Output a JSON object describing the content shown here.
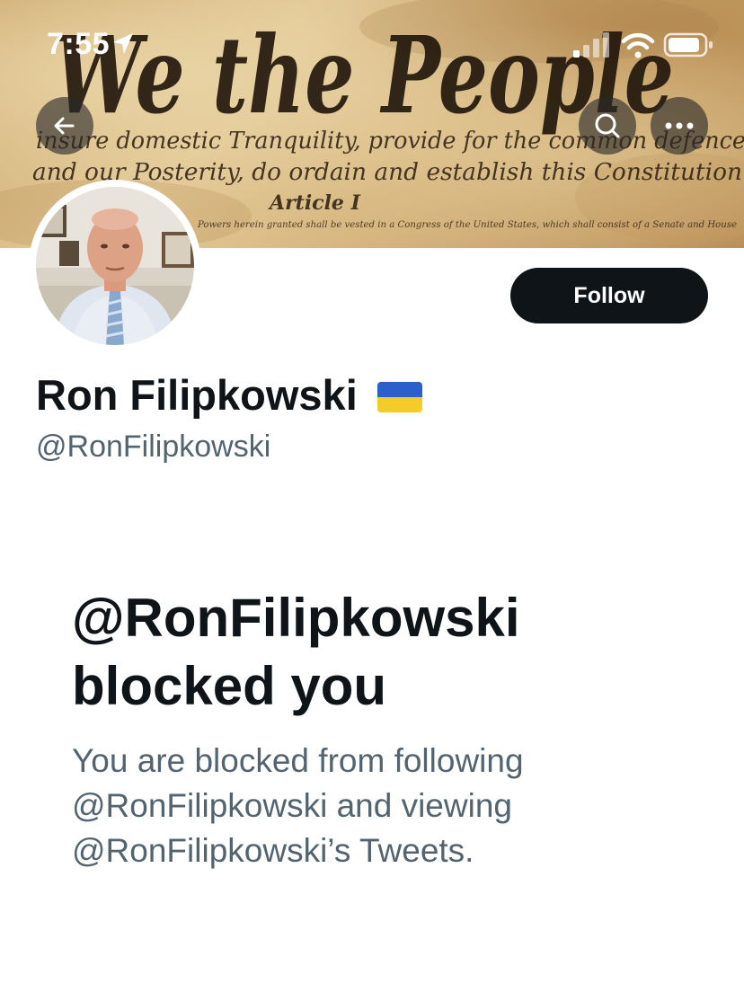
{
  "status_bar": {
    "time": "7:55",
    "icons": [
      "location-arrow-icon",
      "cellular-signal-icon",
      "wifi-icon",
      "battery-icon"
    ]
  },
  "banner": {
    "script_title": "We the People",
    "script_line_1": "insure domestic Tranquility, provide for the common defence",
    "script_line_2": "and our Posterity, do ordain and establish this Constitution",
    "script_article": "Article I",
    "script_line_3": "Powers herein granted shall be vested in a Congress of the United States, which shall consist of a Senate and House"
  },
  "nav": {
    "back_icon": "arrow-left-icon",
    "search_icon": "search-icon",
    "more_icon": "more-horizontal-icon"
  },
  "profile": {
    "display_name": "Ron Filipkowski",
    "flag_icon": "ukraine-flag-icon",
    "handle": "@RonFilipkowski",
    "follow_label": "Follow"
  },
  "blocked": {
    "title_line_1": "@RonFilipkowski",
    "title_line_2": "blocked you",
    "desc_line_1": "You are blocked from following",
    "desc_line_2": "@RonFilipkowski and viewing",
    "desc_line_3": "@RonFilipkowski’s Tweets."
  },
  "colors": {
    "text_primary": "#0f1419",
    "text_secondary": "#536471",
    "follow_bg": "#0f1419",
    "banner_parchment": "#d6b47c"
  }
}
